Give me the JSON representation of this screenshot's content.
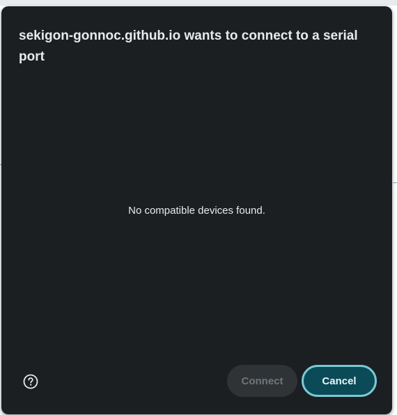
{
  "dialog": {
    "title": "sekigon-gonnoc.github.io wants to connect to a serial port",
    "empty_message": "No compatible devices found.",
    "help_icon": "help-circle-icon",
    "connect_label": "Connect",
    "cancel_label": "Cancel"
  },
  "colors": {
    "dialog_bg": "#1b1f22",
    "text": "#e8eaed",
    "connect_disabled_bg": "#2f3336",
    "connect_disabled_text": "#6f7579",
    "cancel_bg": "#0b4a57",
    "cancel_focus_ring": "#79c9d6"
  }
}
